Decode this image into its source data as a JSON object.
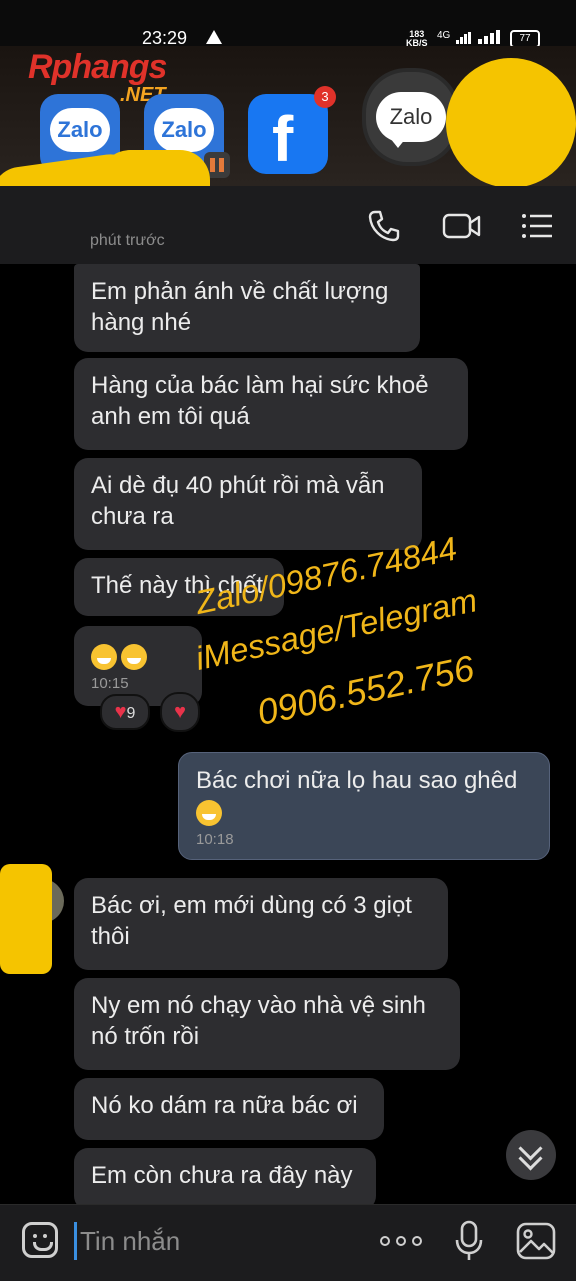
{
  "status_bar": {
    "time": "23:29",
    "speed_value": "183",
    "speed_unit": "KB/S",
    "network": "4G",
    "battery": "77"
  },
  "recents": {
    "logo_main": "Rphangs",
    "logo_suffix": ".NET",
    "apps": [
      {
        "name": "Zalo",
        "label": "Zalo"
      },
      {
        "name": "Zalo",
        "label": "Zalo"
      },
      {
        "name": "Facebook",
        "label": "f",
        "badge": "3"
      },
      {
        "name": "Zalo",
        "label": "Zalo"
      }
    ]
  },
  "header": {
    "subtitle": "phút trước"
  },
  "messages": [
    {
      "side": "in",
      "text": "Em phản ánh về chất lượng hàng nhé"
    },
    {
      "side": "in",
      "text": "Hàng của bác làm hại sức khoẻ anh em tôi quá"
    },
    {
      "side": "in",
      "text": "Ai dè đụ 40 phút rồi mà vẫn chưa ra"
    },
    {
      "side": "in",
      "text": "Thế này thì chết"
    },
    {
      "side": "in",
      "text": "",
      "time": "10:15",
      "reactions": [
        {
          "count": "9"
        },
        {
          "count": ""
        }
      ]
    },
    {
      "side": "out",
      "text": "Bác chơi nữa lọ hau sao ghêd",
      "time": "10:18"
    },
    {
      "side": "in",
      "text": "Bác ơi, em mới dùng có 3 giọt thôi"
    },
    {
      "side": "in",
      "text": "Ny em nó chạy vào nhà vệ sinh nó trốn rồi"
    },
    {
      "side": "in",
      "text": "Nó ko dám ra nữa bác ơi"
    },
    {
      "side": "in",
      "text": "Em còn chưa ra đây này"
    }
  ],
  "watermark": {
    "line1": "Zalo/09876.74844",
    "line2": "iMessage/Telegram",
    "line3": "0906.552.756"
  },
  "input_bar": {
    "placeholder": "Tin nhắn"
  },
  "colors": {
    "accent": "#3a8fe0",
    "incoming_bubble": "#2d2d30",
    "outgoing_bubble": "#3b4657",
    "watermark": "#f0b619"
  }
}
